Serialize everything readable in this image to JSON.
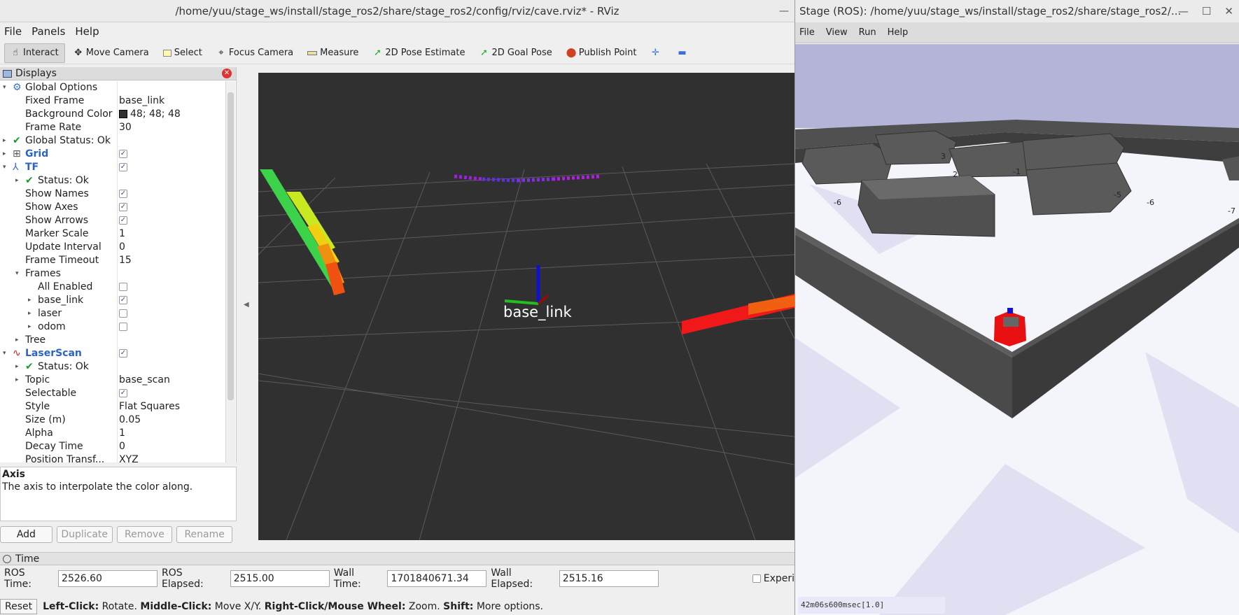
{
  "rviz": {
    "title": "/home/yuu/stage_ws/install/stage_ros2/share/stage_ros2/config/rviz/cave.rviz* - RViz",
    "menu": [
      "File",
      "Panels",
      "Help"
    ],
    "tools": [
      {
        "label": "Interact",
        "icon": "pointer-hand-icon"
      },
      {
        "label": "Move Camera",
        "icon": "move-arrows-icon"
      },
      {
        "label": "Select",
        "icon": "select-box-icon"
      },
      {
        "label": "Focus Camera",
        "icon": "focus-crosshair-icon"
      },
      {
        "label": "Measure",
        "icon": "ruler-icon"
      },
      {
        "label": "2D Pose Estimate",
        "icon": "green-arrow-icon"
      },
      {
        "label": "2D Goal Pose",
        "icon": "green-arrow-icon"
      },
      {
        "label": "Publish Point",
        "icon": "map-pin-icon"
      }
    ],
    "displays_title": "Displays",
    "tree": [
      {
        "indent": 0,
        "arrow": "▾",
        "icon": "gear-icon",
        "label": "Global Options",
        "value": "",
        "style": ""
      },
      {
        "indent": 1,
        "arrow": "",
        "icon": "",
        "label": "Fixed Frame",
        "value": "base_link",
        "style": ""
      },
      {
        "indent": 1,
        "arrow": "",
        "icon": "",
        "label": "Background Color",
        "value": "48; 48; 48",
        "swatch": "#303030",
        "style": ""
      },
      {
        "indent": 1,
        "arrow": "",
        "icon": "",
        "label": "Frame Rate",
        "value": "30",
        "style": ""
      },
      {
        "indent": 0,
        "arrow": "▸",
        "icon": "check-icon",
        "label": "Global Status: Ok",
        "value": "",
        "style": ""
      },
      {
        "indent": 0,
        "arrow": "▸",
        "icon": "grid-icon",
        "label": "Grid",
        "value": "",
        "check": true,
        "style": "blue"
      },
      {
        "indent": 0,
        "arrow": "▾",
        "icon": "tf-icon",
        "label": "TF",
        "value": "",
        "check": true,
        "style": "blue"
      },
      {
        "indent": 1,
        "arrow": "▸",
        "icon": "check-icon",
        "label": "Status: Ok",
        "value": "",
        "style": ""
      },
      {
        "indent": 1,
        "arrow": "",
        "icon": "",
        "label": "Show Names",
        "value": "",
        "check": true,
        "style": ""
      },
      {
        "indent": 1,
        "arrow": "",
        "icon": "",
        "label": "Show Axes",
        "value": "",
        "check": true,
        "style": ""
      },
      {
        "indent": 1,
        "arrow": "",
        "icon": "",
        "label": "Show Arrows",
        "value": "",
        "check": true,
        "style": ""
      },
      {
        "indent": 1,
        "arrow": "",
        "icon": "",
        "label": "Marker Scale",
        "value": "1",
        "style": ""
      },
      {
        "indent": 1,
        "arrow": "",
        "icon": "",
        "label": "Update Interval",
        "value": "0",
        "style": ""
      },
      {
        "indent": 1,
        "arrow": "",
        "icon": "",
        "label": "Frame Timeout",
        "value": "15",
        "style": ""
      },
      {
        "indent": 1,
        "arrow": "▾",
        "icon": "",
        "label": "Frames",
        "value": "",
        "style": ""
      },
      {
        "indent": 2,
        "arrow": "",
        "icon": "",
        "label": "All Enabled",
        "value": "",
        "check": false,
        "style": ""
      },
      {
        "indent": 2,
        "arrow": "▸",
        "icon": "",
        "label": "base_link",
        "value": "",
        "check": true,
        "style": ""
      },
      {
        "indent": 2,
        "arrow": "▸",
        "icon": "",
        "label": "laser",
        "value": "",
        "check": false,
        "style": ""
      },
      {
        "indent": 2,
        "arrow": "▸",
        "icon": "",
        "label": "odom",
        "value": "",
        "check": false,
        "style": ""
      },
      {
        "indent": 1,
        "arrow": "▸",
        "icon": "",
        "label": "Tree",
        "value": "",
        "style": ""
      },
      {
        "indent": 0,
        "arrow": "▾",
        "icon": "laserscan-icon",
        "label": "LaserScan",
        "value": "",
        "check": true,
        "style": "blue"
      },
      {
        "indent": 1,
        "arrow": "▸",
        "icon": "check-icon",
        "label": "Status: Ok",
        "value": "",
        "style": ""
      },
      {
        "indent": 1,
        "arrow": "▸",
        "icon": "",
        "label": "Topic",
        "value": "base_scan",
        "style": ""
      },
      {
        "indent": 1,
        "arrow": "",
        "icon": "",
        "label": "Selectable",
        "value": "",
        "check": true,
        "style": ""
      },
      {
        "indent": 1,
        "arrow": "",
        "icon": "",
        "label": "Style",
        "value": "Flat Squares",
        "style": ""
      },
      {
        "indent": 1,
        "arrow": "",
        "icon": "",
        "label": "Size (m)",
        "value": "0.05",
        "style": ""
      },
      {
        "indent": 1,
        "arrow": "",
        "icon": "",
        "label": "Alpha",
        "value": "1",
        "style": ""
      },
      {
        "indent": 1,
        "arrow": "",
        "icon": "",
        "label": "Decay Time",
        "value": "0",
        "style": ""
      },
      {
        "indent": 1,
        "arrow": "",
        "icon": "",
        "label": "Position Transf...",
        "value": "XYZ",
        "style": ""
      }
    ],
    "desc_title": "Axis",
    "desc_body": "The axis to interpolate the color along.",
    "buttons": [
      {
        "label": "Add",
        "enabled": true
      },
      {
        "label": "Duplicate",
        "enabled": false
      },
      {
        "label": "Remove",
        "enabled": false
      },
      {
        "label": "Rename",
        "enabled": false
      }
    ],
    "viewport_label": "base_link",
    "time_title": "Time",
    "time": {
      "ros_time_label": "ROS Time:",
      "ros_time": "2526.60",
      "ros_elapsed_label": "ROS Elapsed:",
      "ros_elapsed": "2515.00",
      "wall_time_label": "Wall Time:",
      "wall_time": "1701840671.34",
      "wall_elapsed_label": "Wall Elapsed:",
      "wall_elapsed": "2515.16",
      "experimental_label": "Experi"
    },
    "status": {
      "reset": "Reset",
      "text_parts": [
        {
          "b": "Left-Click:",
          "t": " Rotate. "
        },
        {
          "b": "Middle-Click:",
          "t": " Move X/Y. "
        },
        {
          "b": "Right-Click/Mouse Wheel:",
          "t": " Zoom. "
        },
        {
          "b": "Shift:",
          "t": " More options."
        }
      ]
    }
  },
  "stage": {
    "title": "Stage (ROS): /home/yuu/stage_ws/install/stage_ros2/share/stage_ros2/...",
    "menu": [
      "File",
      "View",
      "Run",
      "Help"
    ],
    "status": "42m06s600msec[1.0]",
    "axis_labels": [
      "-6",
      "-5",
      "-6",
      "-1",
      "-7",
      "3",
      "2"
    ]
  }
}
